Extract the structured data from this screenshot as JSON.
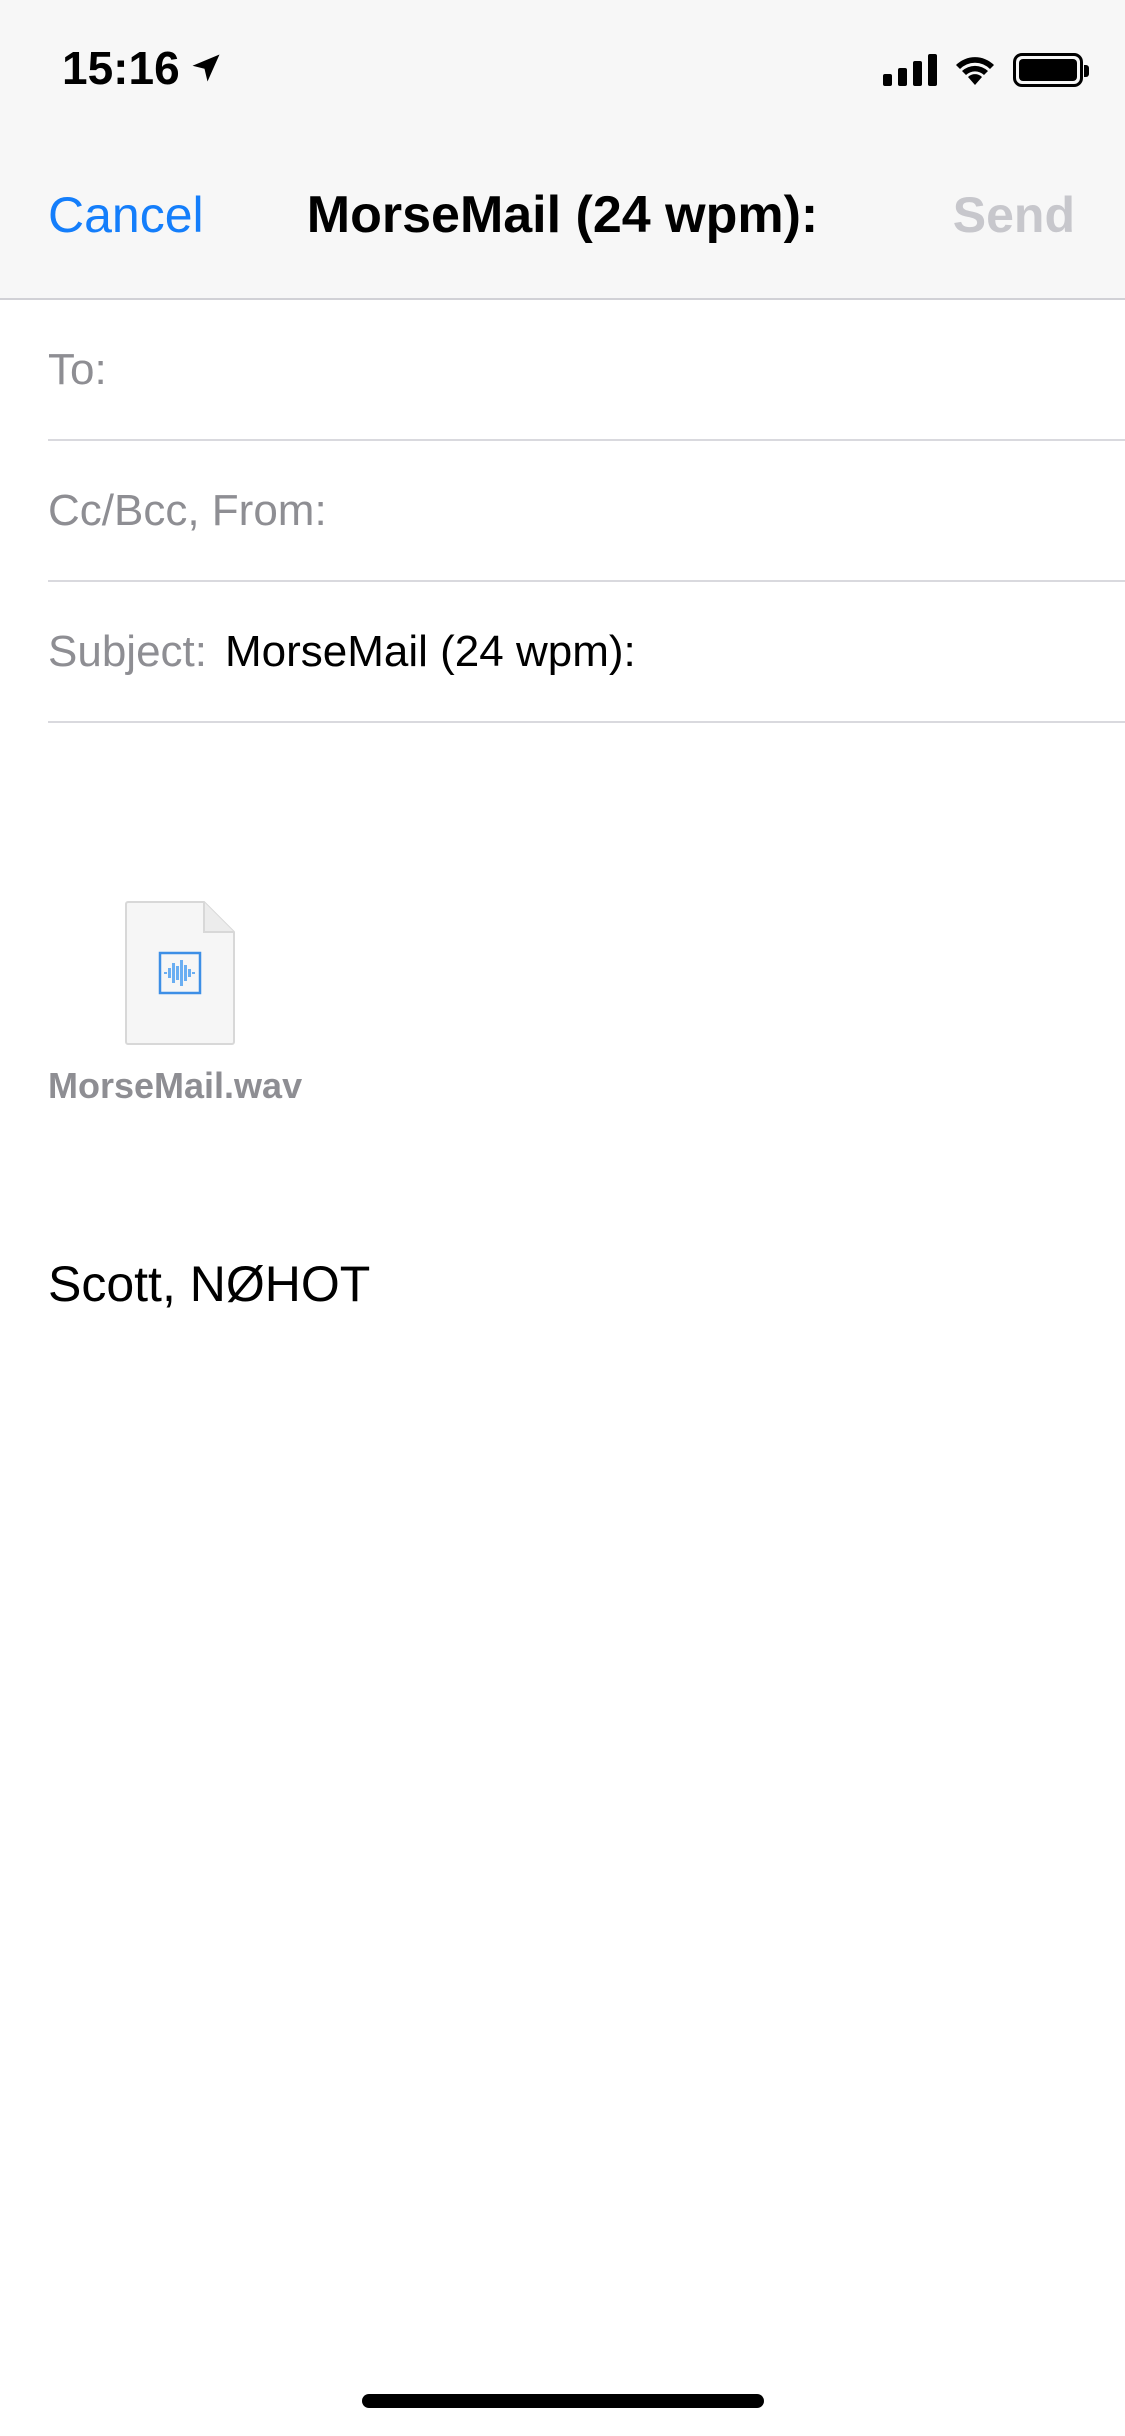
{
  "status_bar": {
    "time": "15:16"
  },
  "nav": {
    "cancel_label": "Cancel",
    "title": "MorseMail (24 wpm):",
    "send_label": "Send"
  },
  "fields": {
    "to_label": "To:",
    "cc_label": "Cc/Bcc, From:",
    "subject_label": "Subject:",
    "subject_value": "MorseMail (24 wpm):"
  },
  "attachment": {
    "filename": "MorseMail.wav"
  },
  "body": {
    "signature": "Scott, NØHOT"
  },
  "colors": {
    "accent": "#147efb",
    "disabled": "#c7c7cc",
    "label_gray": "#8e8e93"
  },
  "icons": [
    "location-arrow-icon",
    "cellular-signal-icon",
    "wifi-icon",
    "battery-icon",
    "audio-file-icon"
  ]
}
